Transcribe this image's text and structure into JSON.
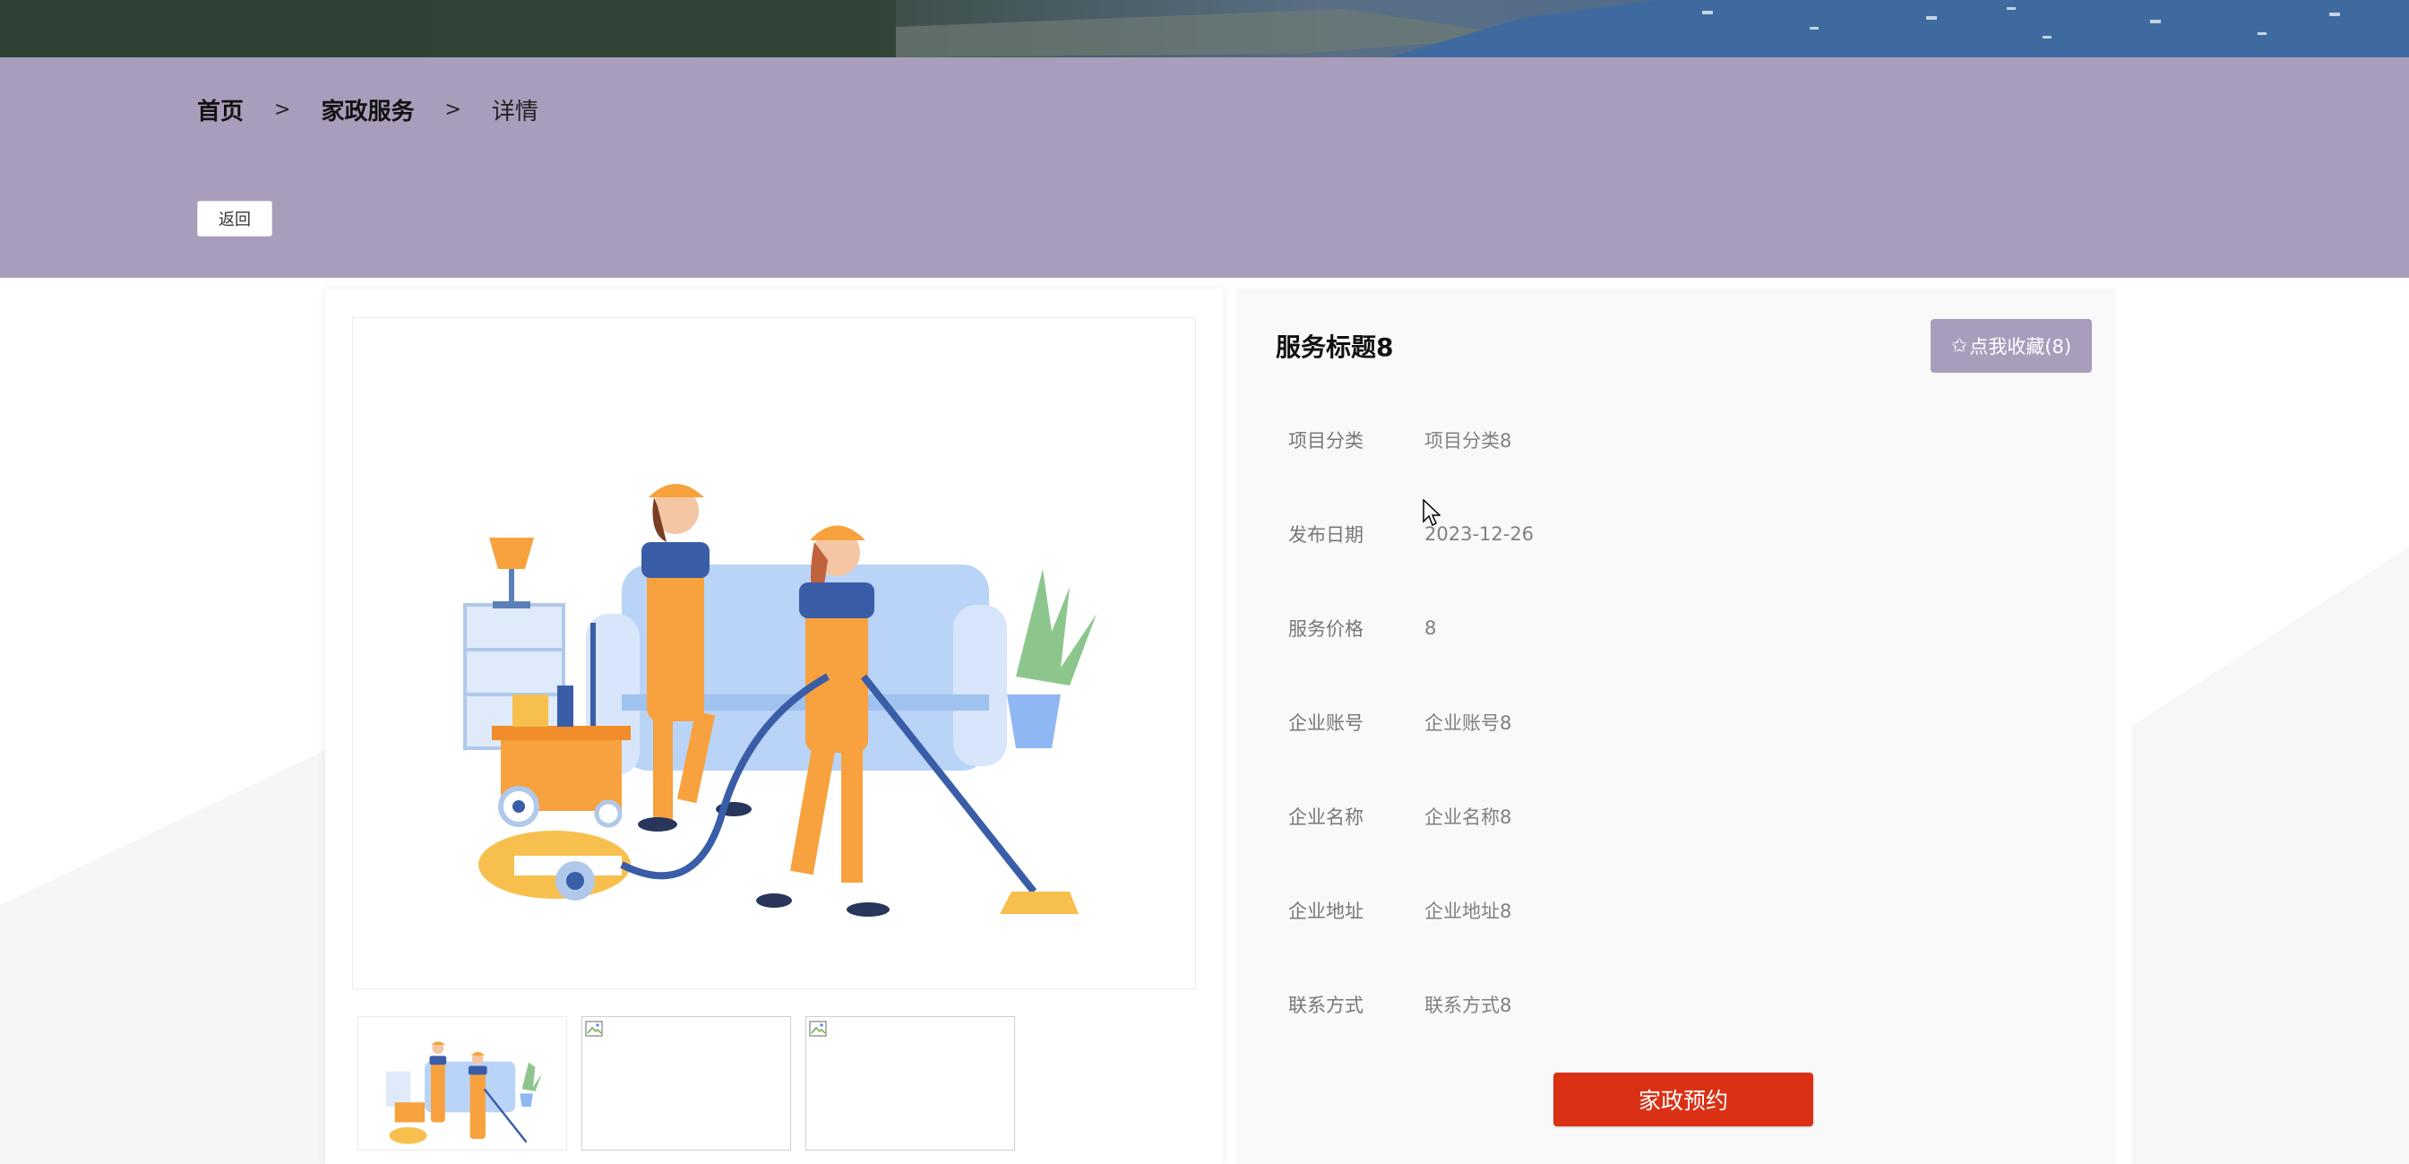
{
  "breadcrumb": {
    "home": "首页",
    "section": "家政服务",
    "current": "详情",
    "separator": ">"
  },
  "back_button": {
    "label": "返回"
  },
  "service": {
    "title": "服务标题8",
    "favorite_button": {
      "star": "✩",
      "label": "点我收藏(8)"
    },
    "fields": [
      {
        "label": "项目分类",
        "value": "项目分类8"
      },
      {
        "label": "发布日期",
        "value": "2023-12-26"
      },
      {
        "label": "服务价格",
        "value": "8"
      },
      {
        "label": "企业账号",
        "value": "企业账号8"
      },
      {
        "label": "企业名称",
        "value": "企业名称8"
      },
      {
        "label": "企业地址",
        "value": "企业地址8"
      },
      {
        "label": "联系方式",
        "value": "联系方式8"
      }
    ],
    "book_button": {
      "label": "家政预约"
    }
  },
  "gallery": {
    "thumbnails": [
      {
        "state": "loaded",
        "icon": "cleaning-illustration"
      },
      {
        "state": "broken",
        "icon": "broken-image-icon"
      },
      {
        "state": "broken",
        "icon": "broken-image-icon"
      }
    ]
  },
  "colors": {
    "header_band": "#a99dbc",
    "favorite_button": "#a99dbc",
    "book_button": "#da3115"
  }
}
